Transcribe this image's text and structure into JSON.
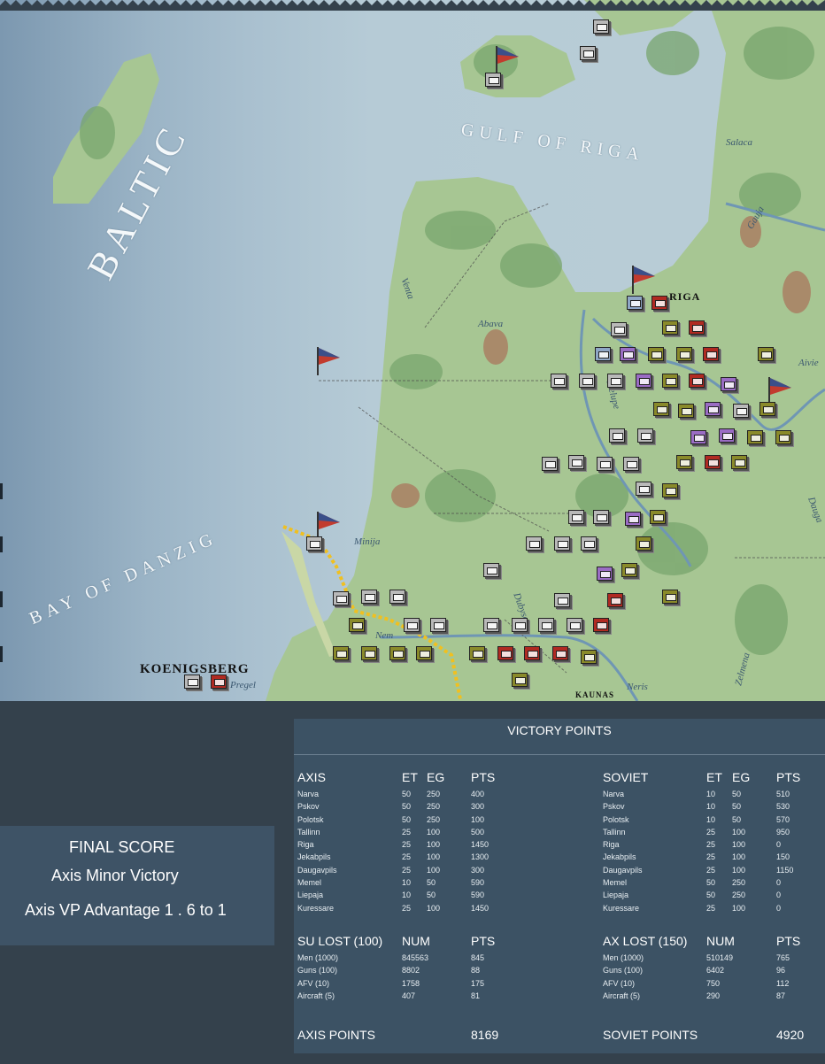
{
  "map": {
    "sea_labels": [
      "BALTIC",
      "GULF OF RIGA",
      "BAY OF DANZIG"
    ],
    "river_labels": [
      "Abava",
      "Venta",
      "Minija",
      "Salaca",
      "Gauja",
      "Aivie",
      "Dubysa",
      "Neris",
      "Zelmena",
      "Nem",
      "Pregel",
      "Dauga",
      "Lielupe"
    ],
    "city_labels": [
      "KOENIGSBERG",
      "KAUNAS",
      "RIGA"
    ],
    "colors": {
      "sea_deep": "#7c98b0",
      "sea_shallow": "#b6cbd6",
      "land": "#9ec28e",
      "forest": "#6f9f68"
    }
  },
  "final_score": {
    "title": "FINAL SCORE",
    "result": "Axis Minor Victory",
    "advantage": "Axis VP Advantage 1 . 6 to 1"
  },
  "victory_points": {
    "title": "VICTORY POINTS",
    "axis": {
      "header": {
        "name": "AXIS",
        "et": "ET",
        "eg": "EG",
        "pts": "PTS"
      },
      "rows": [
        {
          "name": "Narva",
          "et": "50",
          "eg": "250",
          "pts": "400"
        },
        {
          "name": "Pskov",
          "et": "50",
          "eg": "250",
          "pts": "300"
        },
        {
          "name": "Polotsk",
          "et": "50",
          "eg": "250",
          "pts": "100"
        },
        {
          "name": "Tallinn",
          "et": "25",
          "eg": "100",
          "pts": "500"
        },
        {
          "name": "Riga",
          "et": "25",
          "eg": "100",
          "pts": "1450"
        },
        {
          "name": "Jekabpils",
          "et": "25",
          "eg": "100",
          "pts": "1300"
        },
        {
          "name": "Daugavpils",
          "et": "25",
          "eg": "100",
          "pts": "300"
        },
        {
          "name": "Memel",
          "et": "10",
          "eg": "50",
          "pts": "590"
        },
        {
          "name": "Liepaja",
          "et": "10",
          "eg": "50",
          "pts": "590"
        },
        {
          "name": "Kuressare",
          "et": "25",
          "eg": "100",
          "pts": "1450"
        }
      ]
    },
    "soviet": {
      "header": {
        "name": "SOVIET",
        "et": "ET",
        "eg": "EG",
        "pts": "PTS"
      },
      "rows": [
        {
          "name": "Narva",
          "et": "10",
          "eg": "50",
          "pts": "510"
        },
        {
          "name": "Pskov",
          "et": "10",
          "eg": "50",
          "pts": "530"
        },
        {
          "name": "Polotsk",
          "et": "10",
          "eg": "50",
          "pts": "570"
        },
        {
          "name": "Tallinn",
          "et": "25",
          "eg": "100",
          "pts": "950"
        },
        {
          "name": "Riga",
          "et": "25",
          "eg": "100",
          "pts": "0"
        },
        {
          "name": "Jekabpils",
          "et": "25",
          "eg": "100",
          "pts": "150"
        },
        {
          "name": "Daugavpils",
          "et": "25",
          "eg": "100",
          "pts": "1150"
        },
        {
          "name": "Memel",
          "et": "50",
          "eg": "250",
          "pts": "0"
        },
        {
          "name": "Liepaja",
          "et": "50",
          "eg": "250",
          "pts": "0"
        },
        {
          "name": "Kuressare",
          "et": "25",
          "eg": "100",
          "pts": "0"
        }
      ]
    },
    "su_lost": {
      "header": {
        "name": "SU LOST (100)",
        "num": "NUM",
        "pts": "PTS"
      },
      "rows": [
        {
          "name": "Men (1000)",
          "num": "845563",
          "pts": "845"
        },
        {
          "name": "Guns (100)",
          "num": "8802",
          "pts": "88"
        },
        {
          "name": "AFV (10)",
          "num": "1758",
          "pts": "175"
        },
        {
          "name": "Aircraft (5)",
          "num": "407",
          "pts": "81"
        }
      ]
    },
    "ax_lost": {
      "header": {
        "name": "AX LOST (150)",
        "num": "NUM",
        "pts": "PTS"
      },
      "rows": [
        {
          "name": "Men (1000)",
          "num": "510149",
          "pts": "765"
        },
        {
          "name": "Guns (100)",
          "num": "6402",
          "pts": "96"
        },
        {
          "name": "AFV (10)",
          "num": "750",
          "pts": "112"
        },
        {
          "name": "Aircraft (5)",
          "num": "290",
          "pts": "87"
        }
      ]
    },
    "totals": {
      "axis_label": "AXIS POINTS",
      "axis_value": "8169",
      "soviet_label": "SOVIET POINTS",
      "soviet_value": "4920"
    }
  }
}
